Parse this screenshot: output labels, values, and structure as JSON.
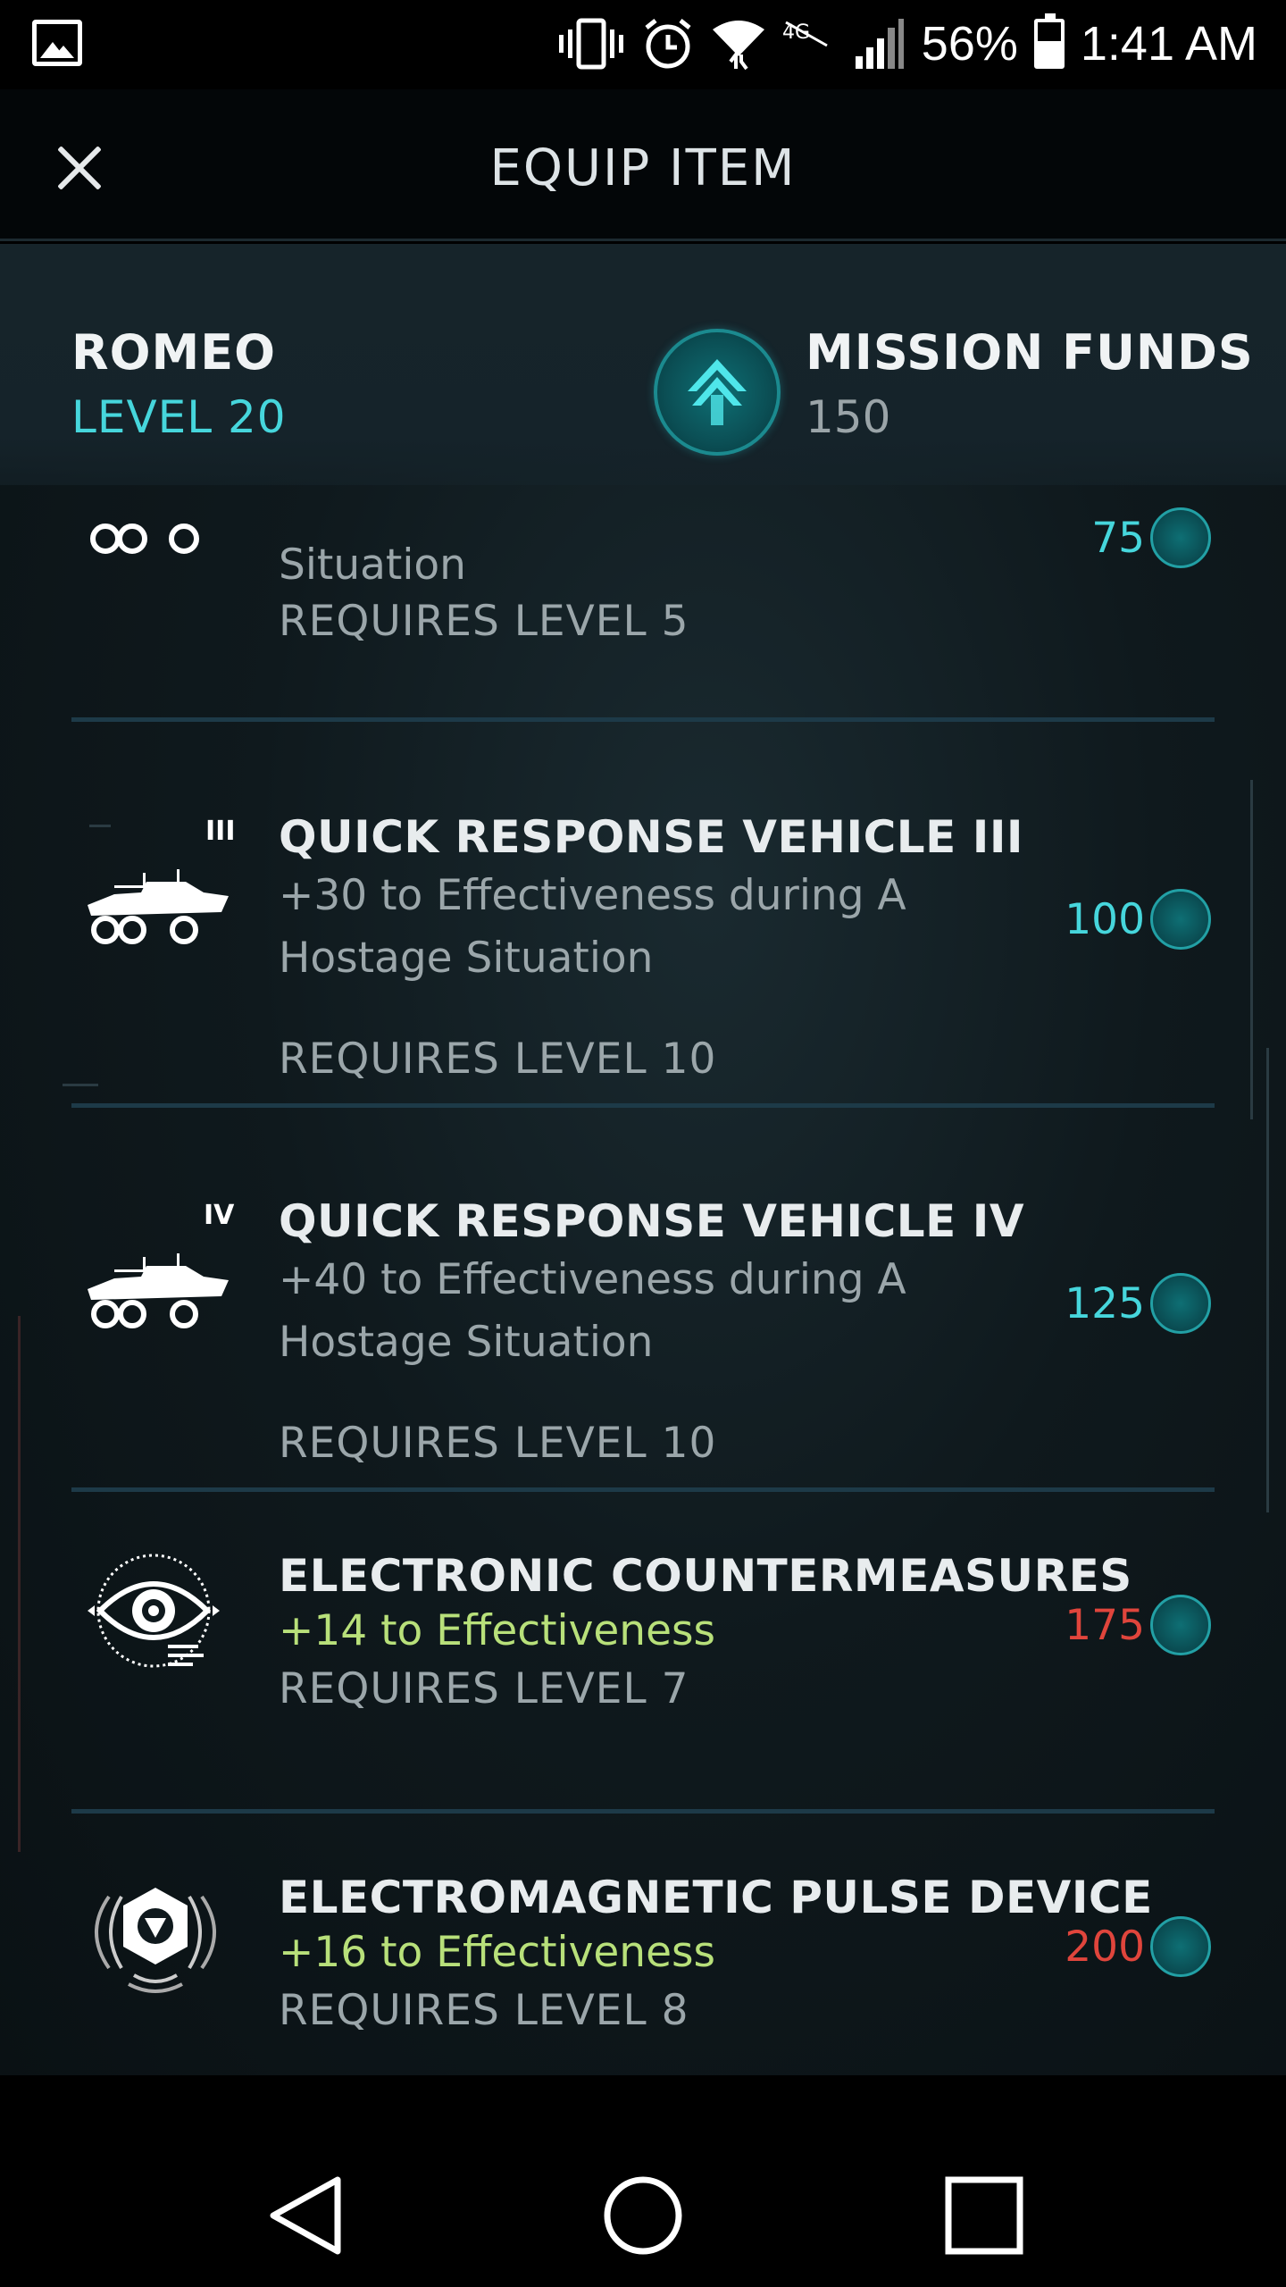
{
  "status_bar": {
    "battery": "56%",
    "time": "1:41 AM",
    "network": "4G"
  },
  "header": {
    "title": "EQUIP ITEM"
  },
  "profile": {
    "name": "ROMEO",
    "level": "LEVEL 20"
  },
  "funds": {
    "label": "MISSION FUNDS",
    "value": "150"
  },
  "items": [
    {
      "title": "",
      "desc": "Situation",
      "req": "REQUIRES LEVEL 5",
      "cost": "75",
      "icon": "vehicle-icon"
    },
    {
      "title": "QUICK RESPONSE VEHICLE III",
      "roman": "III",
      "desc": "+30 to Effectiveness during A Hostage Situation",
      "req": "REQUIRES LEVEL 10",
      "cost": "100",
      "icon": "vehicle-icon"
    },
    {
      "title": "QUICK RESPONSE VEHICLE IV",
      "roman": "IV",
      "desc": "+40 to Effectiveness during A Hostage Situation",
      "req": "REQUIRES LEVEL 10",
      "cost": "125",
      "icon": "vehicle-icon"
    },
    {
      "title": "ELECTRONIC COUNTERMEASURES",
      "desc": "+14 to Effectiveness",
      "req": "REQUIRES LEVEL 7",
      "cost": "175",
      "icon": "eye-icon"
    },
    {
      "title": "ELECTROMAGNETIC PULSE DEVICE",
      "desc": "+16 to Effectiveness",
      "req": "REQUIRES LEVEL 8",
      "cost": "200",
      "icon": "pulse-device-icon"
    }
  ],
  "colors": {
    "accent": "#46d6dc",
    "unaffordable": "#e0453c",
    "bonus": "#b8e07a"
  }
}
